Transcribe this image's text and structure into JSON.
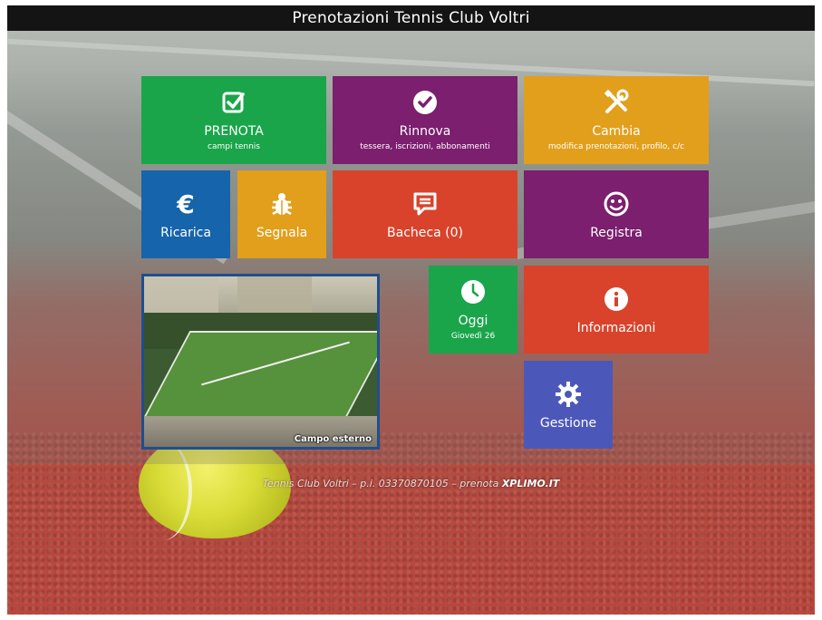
{
  "header": {
    "title": "Prenotazioni Tennis Club Voltri"
  },
  "tiles": {
    "prenota": {
      "label": "PRENOTA",
      "sub": "campi tennis",
      "icon": "checkbox-icon",
      "color": "#1aa54a"
    },
    "rinnova": {
      "label": "Rinnova",
      "sub": "tessera, iscrizioni, abbonamenti",
      "icon": "check-circle-icon",
      "color": "#7b1f6e"
    },
    "cambia": {
      "label": "Cambia",
      "sub": "modifica prenotazioni, profilo, c/c",
      "icon": "tools-icon",
      "color": "#e29f1c"
    },
    "ricarica": {
      "label": "Ricarica",
      "icon": "euro-icon",
      "color": "#1664ab"
    },
    "segnala": {
      "label": "Segnala",
      "icon": "bug-icon",
      "color": "#e29f1c"
    },
    "bacheca": {
      "label": "Bacheca (0)",
      "icon": "message-icon",
      "color": "#d9432b"
    },
    "registra": {
      "label": "Registra",
      "icon": "smiley-icon",
      "color": "#7b1f6e"
    },
    "oggi": {
      "label": "Oggi",
      "sub": "Giovedì 26",
      "icon": "clock-icon",
      "color": "#1aa54a"
    },
    "informazioni": {
      "label": "Informazioni",
      "icon": "info-icon",
      "color": "#d9432b"
    },
    "gestione": {
      "label": "Gestione",
      "icon": "gear-icon",
      "color": "#4c58b9"
    }
  },
  "photo": {
    "caption": "Campo esterno"
  },
  "footer": {
    "club": "Tennis Club Voltri",
    "vat": "p.i. 03370870105",
    "prenota_prefix": "prenota",
    "brand": "XPLIMO.IT"
  }
}
